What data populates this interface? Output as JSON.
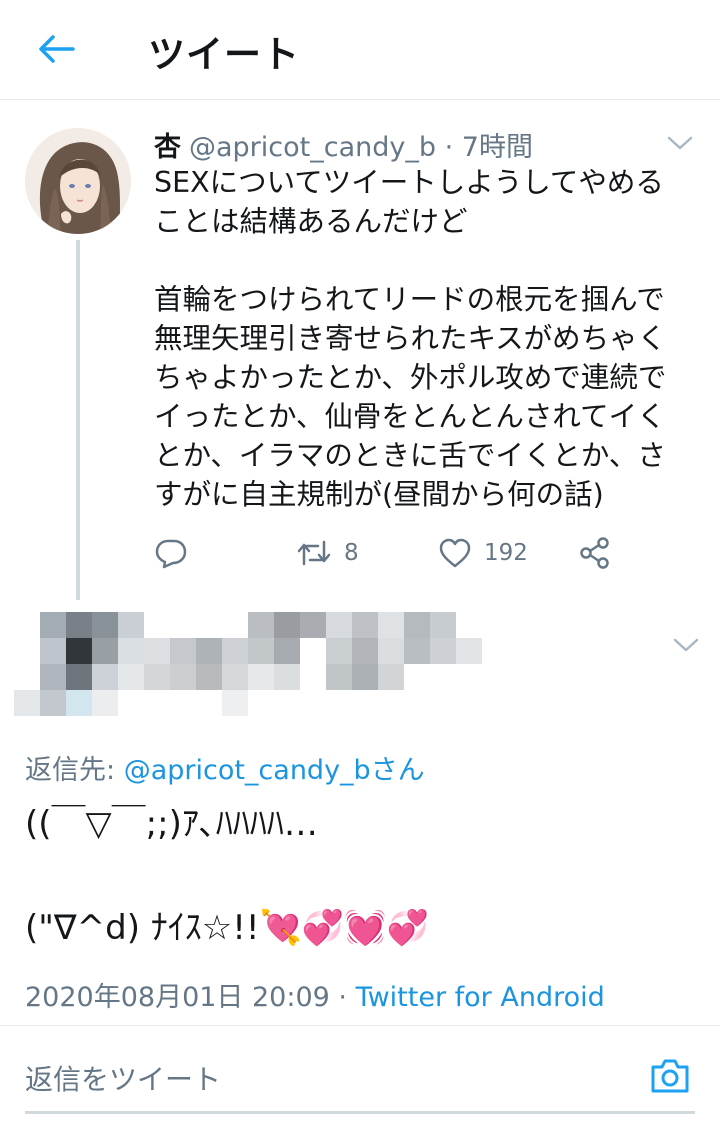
{
  "header": {
    "title": "ツイート"
  },
  "tweet": {
    "author_name": "杏",
    "handle": "@apricot_candy_b",
    "separator": "·",
    "time": "7時間",
    "text": "SEXについてツイートしようしてやめる\nことは結構あるんだけど\n\n首輪をつけられてリードの根元を掴んで\n無理矢理引き寄せられたキスがめちゃく\nちゃよかったとか、外ポル攻めで連続で\nイったとか、仙骨をとんとんされてイく\nとか、イラマのときに舌でイくとか、さ\nすがに自主規制が(昼間から何の話)",
    "retweets": "8",
    "likes": "192"
  },
  "reply": {
    "reply_to_label": "返信先: ",
    "reply_to_handle": "@apricot_candy_bさん",
    "text": "((￣▽￣;;)ｱ､ﾊﾊﾊﾊ…\n\n(\"∇^d) ﾅｲｽ☆!!💘💞💓💞",
    "datetime": "2020年08月01日 20:09",
    "separator": " · ",
    "source": "Twitter for Android"
  },
  "compose": {
    "placeholder": "返信をツイート"
  },
  "colors": {
    "accent": "#1da1f2",
    "link": "#1b95e0",
    "secondary_text": "#657786",
    "primary_text": "#14171a"
  }
}
